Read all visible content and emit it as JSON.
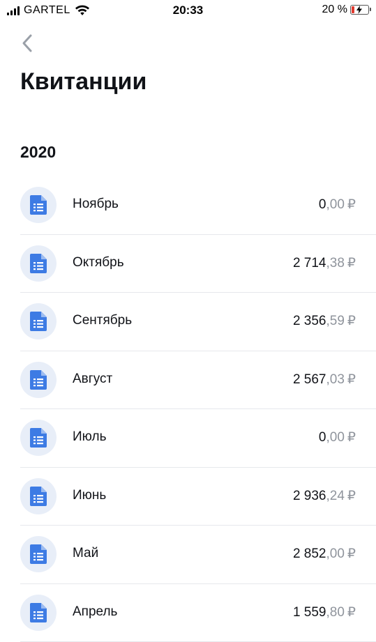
{
  "status_bar": {
    "carrier": "GARTEL",
    "time": "20:33",
    "battery_percent_label": "20 %",
    "battery_level": 0.2,
    "icons": [
      "signal-icon",
      "wifi-icon",
      "battery-charging-icon"
    ]
  },
  "header": {
    "back_icon": "chevron-left-icon",
    "title": "Квитанции"
  },
  "year": "2020",
  "receipts": [
    {
      "month": "Ноябрь",
      "amount_int": "0",
      "amount_dec": "00",
      "currency": "₽"
    },
    {
      "month": "Октябрь",
      "amount_int": "2 714",
      "amount_dec": "38",
      "currency": "₽"
    },
    {
      "month": "Сентябрь",
      "amount_int": "2 356",
      "amount_dec": "59",
      "currency": "₽"
    },
    {
      "month": "Август",
      "amount_int": "2 567",
      "amount_dec": "03",
      "currency": "₽"
    },
    {
      "month": "Июль",
      "amount_int": "0",
      "amount_dec": "00",
      "currency": "₽"
    },
    {
      "month": "Июнь",
      "amount_int": "2 936",
      "amount_dec": "24",
      "currency": "₽"
    },
    {
      "month": "Май",
      "amount_int": "2 852",
      "amount_dec": "00",
      "currency": "₽"
    },
    {
      "month": "Апрель",
      "amount_int": "1 559",
      "amount_dec": "80",
      "currency": "₽"
    }
  ],
  "colors": {
    "accent": "#3d7be4",
    "icon_bg": "#e8eef8",
    "battery_low": "#e03a2f",
    "secondary_text": "#8f949c"
  }
}
